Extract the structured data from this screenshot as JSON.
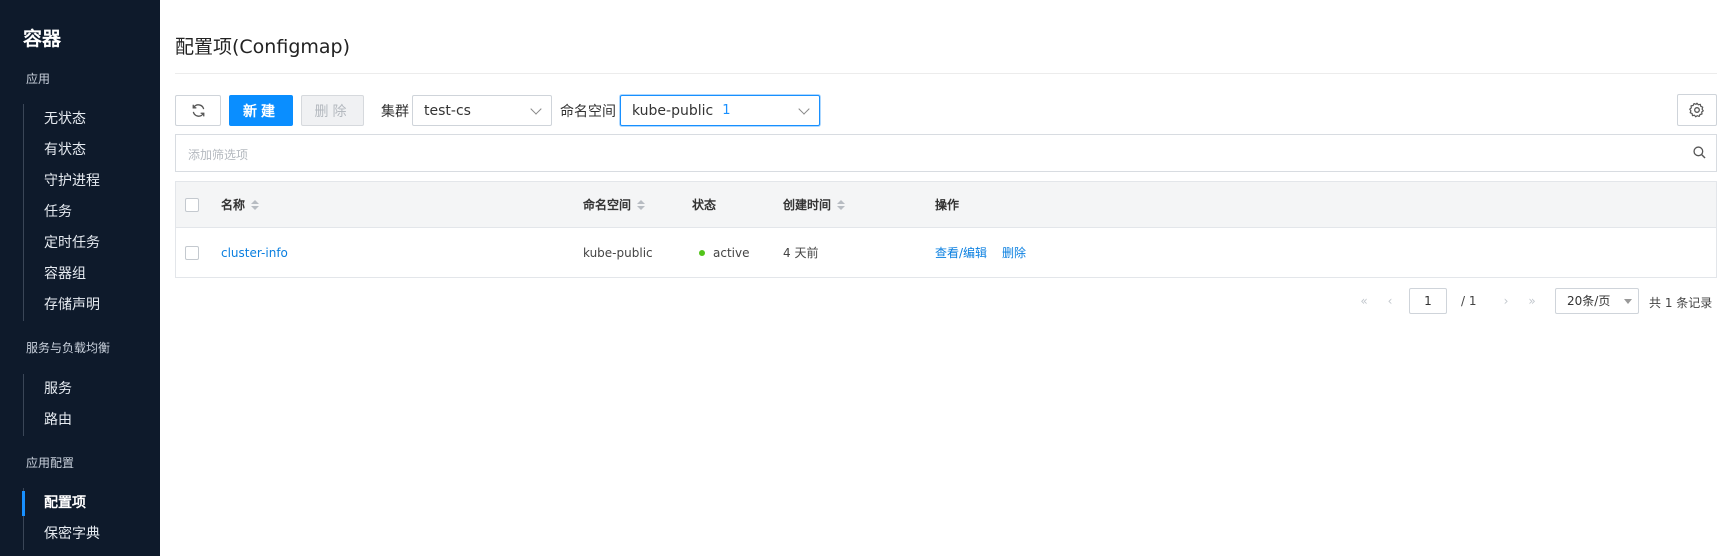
{
  "sidebar": {
    "title": "容器",
    "groups": [
      {
        "label": "应用",
        "items": [
          "无状态",
          "有状态",
          "守护进程",
          "任务",
          "定时任务",
          "容器组",
          "存储声明"
        ]
      },
      {
        "label": "服务与负载均衡",
        "items": [
          "服务",
          "路由"
        ]
      },
      {
        "label": "应用配置",
        "items": [
          "配置项",
          "保密字典"
        ]
      }
    ],
    "active_item": "配置项"
  },
  "page": {
    "title": "配置项(Configmap)"
  },
  "toolbar": {
    "refresh_icon": "refresh-icon",
    "new_label": "新建",
    "delete_label": "删除",
    "cluster_label": "集群",
    "cluster_value": "test-cs",
    "namespace_label": "命名空间",
    "namespace_value": "kube-public",
    "namespace_count": "1",
    "settings_icon": "gear-icon"
  },
  "filter": {
    "placeholder": "添加筛选项",
    "search_icon": "search-icon"
  },
  "table": {
    "columns": [
      "名称",
      "命名空间",
      "状态",
      "创建时间",
      "操作"
    ],
    "rows": [
      {
        "name": "cluster-info",
        "namespace": "kube-public",
        "status": "active",
        "status_color": "#52c41a",
        "created": "4 天前",
        "actions": [
          "查看/编辑",
          "删除"
        ]
      }
    ]
  },
  "pagination": {
    "current_page": "1",
    "total_pages": "/ 1",
    "page_size": "20条/页",
    "total_records": "共 1 条记录"
  },
  "colors": {
    "sidebar_bg": "#0e1a2b",
    "primary": "#0a8eff",
    "link": "#0a7fe0"
  }
}
